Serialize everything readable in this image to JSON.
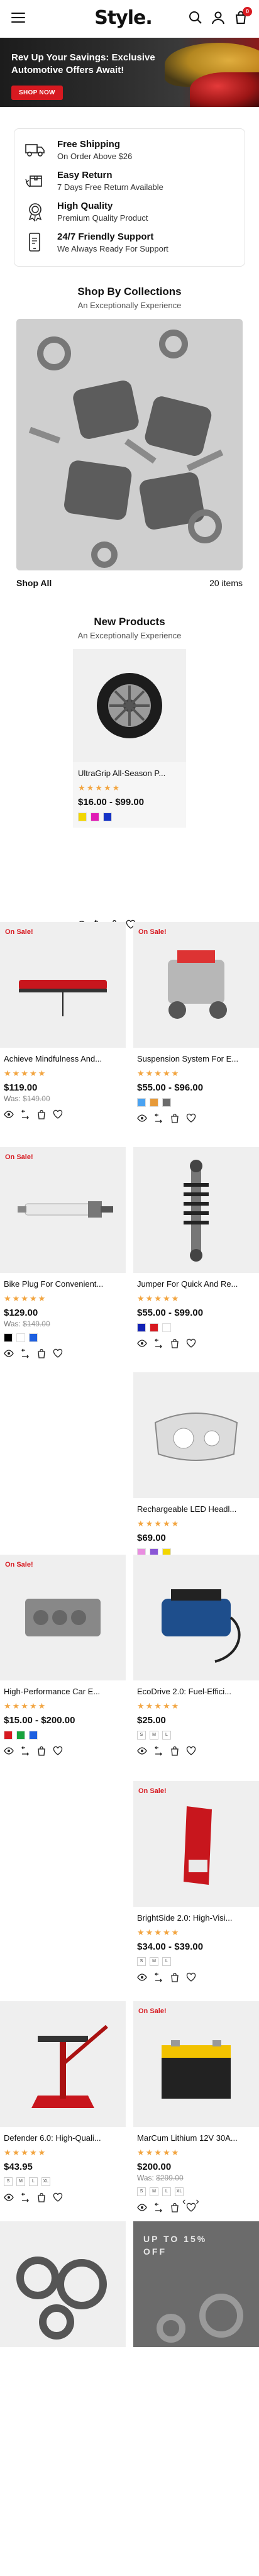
{
  "header": {
    "logo": "Style.",
    "cart_count": "0"
  },
  "hero": {
    "headline": "Rev Up Your Savings: Exclusive Automotive Offers Await!",
    "cta": "SHOP NOW"
  },
  "features": [
    {
      "icon": "truck-icon",
      "title": "Free Shipping",
      "subtitle": "On Order Above $26"
    },
    {
      "icon": "return-box-icon",
      "title": "Easy Return",
      "subtitle": "7 Days Free Return Available"
    },
    {
      "icon": "quality-badge-icon",
      "title": "High Quality",
      "subtitle": "Premium Quality Product"
    },
    {
      "icon": "support-phone-icon",
      "title": "24/7 Friendly Support",
      "subtitle": "We Always Ready For Support"
    }
  ],
  "collections": {
    "title": "Shop By Collections",
    "subtitle": "An Exceptionally Experience",
    "link": "Shop All",
    "count": "20 items"
  },
  "new_products": {
    "title": "New Products",
    "subtitle": "An Exceptionally Experience"
  },
  "featured_product": {
    "name": "UltraGrip All-Season P...",
    "stars": "★★★★★",
    "price": "$16.00 - $99.00",
    "swatches": [
      "#f2d600",
      "#e01bb4",
      "#1533c6"
    ]
  },
  "products": [
    {
      "name": "Achieve Mindfulness And...",
      "sale": "On Sale!",
      "stars": "★★★★★",
      "price": "$119.00",
      "was": "$149.00",
      "was_label": "Was:"
    },
    {
      "name": "Suspension System For E...",
      "sale": "On Sale!",
      "stars": "★★★★★",
      "price": "$55.00 - $96.00",
      "swatches": [
        "#4aa3f2",
        "#e79a39",
        "#6c6c6c"
      ]
    },
    {
      "name": "Bike Plug For Convenient...",
      "sale": "On Sale!",
      "stars": "★★★★★",
      "price": "$129.00",
      "was": "$149.00",
      "was_label": "Was:",
      "swatches": [
        "#000000",
        "#ffffff",
        "#1d5fe0"
      ]
    },
    {
      "name": "Jumper For Quick And Re...",
      "sale": "",
      "stars": "★★★★★",
      "price": "$55.00 - $99.00",
      "swatches": [
        "#1222b5",
        "#d71920",
        "#ffffff"
      ]
    },
    {
      "name": "Rechargeable LED Headl...",
      "sale": "",
      "stars": "★★★★★",
      "price": "$69.00",
      "swatches": [
        "#e98ee0",
        "#8a56d6",
        "#f2d600"
      ]
    },
    {
      "name": "High-Performance Car E...",
      "sale": "On Sale!",
      "stars": "★★★★★",
      "price": "$15.00 - $200.00",
      "swatches": [
        "#d71920",
        "#18a33d",
        "#1d5fe0"
      ]
    },
    {
      "name": "EcoDrive 2.0: Fuel-Effici...",
      "sale": "",
      "stars": "★★★★★",
      "price": "$25.00",
      "sizes": [
        "S",
        "M",
        "L"
      ]
    },
    {
      "name": "BrightSide 2.0: High-Visi...",
      "sale": "On Sale!",
      "stars": "★★★★★",
      "price": "$34.00 - $39.00",
      "sizes": [
        "S",
        "M",
        "L"
      ]
    },
    {
      "name": "Defender 6.0: High-Quali...",
      "sale": "",
      "stars": "★★★★★",
      "price": "$43.95",
      "sizes": [
        "S",
        "M",
        "L",
        "XL"
      ]
    },
    {
      "name": "MarCum Lithium 12V 30A...",
      "sale": "On Sale!",
      "stars": "★★★★★",
      "price": "$200.00",
      "was": "$299.00",
      "was_label": "Was:",
      "sizes": [
        "S",
        "M",
        "L",
        "XL"
      ]
    }
  ],
  "pager": {
    "prev": "‹",
    "next": "›"
  },
  "promo": {
    "text": "UP TO 15% OFF"
  }
}
